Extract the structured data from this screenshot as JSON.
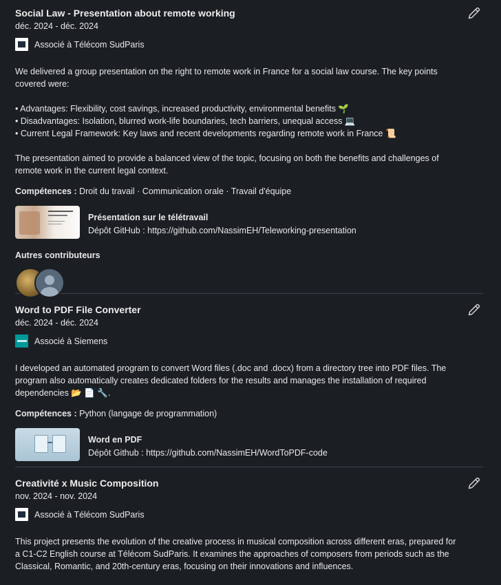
{
  "projects": [
    {
      "title": "Social Law - Presentation about remote working",
      "dates": "déc. 2024 - déc. 2024",
      "association": "Associé à Télécom SudParis",
      "description": [
        "We delivered a group presentation on the right to remote work in France for a social law course. The key points covered were:",
        "",
        "• Advantages: Flexibility, cost savings, increased productivity, environmental benefits 🌱",
        "• Disadvantages: Isolation, blurred work-life boundaries, tech barriers, unequal access 💻",
        "• Current Legal Framework: Key laws and recent developments regarding remote work in France 📜",
        "",
        "The presentation aimed to provide a balanced view of the topic, focusing on both the benefits and challenges of remote work in the current legal context."
      ],
      "skills_label": "Compétences :",
      "skills": "Droit du travail · Communication orale · Travail d'équipe",
      "media": {
        "title": "Présentation sur le télétravail",
        "subtitle": "Dépôt GitHub : https://github.com/NassimEH/Teleworking-presentation"
      },
      "contributors_label": "Autres contributeurs"
    },
    {
      "title": "Word to PDF File Converter",
      "dates": "déc. 2024 - déc. 2024",
      "association": "Associé à Siemens",
      "description": [
        "I developed an automated program to convert Word files (.doc and .docx) from a directory tree into PDF files. The program also automatically creates dedicated folders for the results and manages the installation of required dependencies 📂 📄 🔧."
      ],
      "skills_label": "Compétences :",
      "skills": "Python (langage de programmation)",
      "media": {
        "title": "Word en PDF",
        "subtitle": "Dépôt Github : https://github.com/NassimEH/WordToPDF-code"
      }
    },
    {
      "title": "Creativité x Music Composition",
      "dates": "nov. 2024 - nov. 2024",
      "association": "Associé à Télécom SudParis",
      "description": [
        "This project presents the evolution of the creative process in musical composition across different eras, prepared for a C1-C2 English course at Télécom SudParis. It examines the approaches of composers from periods such as the Classical, Romantic, and 20th-century eras, focusing on their innovations and influences."
      ]
    }
  ],
  "colors": {
    "background": "#1b1f23",
    "text": "#e8e8e8",
    "divider": "#38434f",
    "siemens": "#009999"
  },
  "icons": {
    "edit": "pencil-icon"
  }
}
